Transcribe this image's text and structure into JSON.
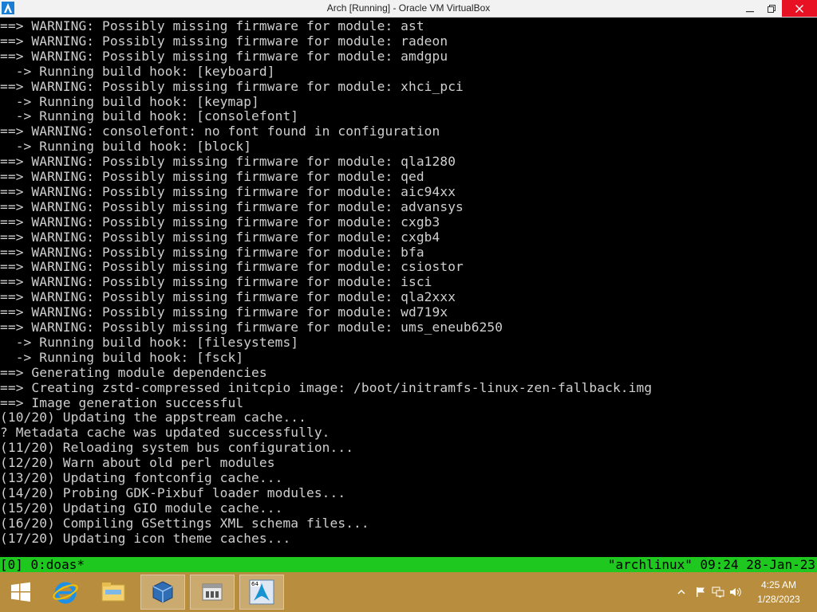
{
  "window": {
    "title": "Arch [Running] - Oracle VM VirtualBox",
    "controls": {
      "minimize": "—",
      "maximize": "❐",
      "close": "✕"
    }
  },
  "console": {
    "lines": [
      "==> WARNING: Possibly missing firmware for module: ast",
      "==> WARNING: Possibly missing firmware for module: radeon",
      "==> WARNING: Possibly missing firmware for module: amdgpu",
      "  -> Running build hook: [keyboard]",
      "==> WARNING: Possibly missing firmware for module: xhci_pci",
      "  -> Running build hook: [keymap]",
      "  -> Running build hook: [consolefont]",
      "==> WARNING: consolefont: no font found in configuration",
      "  -> Running build hook: [block]",
      "==> WARNING: Possibly missing firmware for module: qla1280",
      "==> WARNING: Possibly missing firmware for module: qed",
      "==> WARNING: Possibly missing firmware for module: aic94xx",
      "==> WARNING: Possibly missing firmware for module: advansys",
      "==> WARNING: Possibly missing firmware for module: cxgb3",
      "==> WARNING: Possibly missing firmware for module: cxgb4",
      "==> WARNING: Possibly missing firmware for module: bfa",
      "==> WARNING: Possibly missing firmware for module: csiostor",
      "==> WARNING: Possibly missing firmware for module: isci",
      "==> WARNING: Possibly missing firmware for module: qla2xxx",
      "==> WARNING: Possibly missing firmware for module: wd719x",
      "==> WARNING: Possibly missing firmware for module: ums_eneub6250",
      "  -> Running build hook: [filesystems]",
      "  -> Running build hook: [fsck]",
      "==> Generating module dependencies",
      "==> Creating zstd-compressed initcpio image: /boot/initramfs-linux-zen-fallback.img",
      "==> Image generation successful",
      "(10/20) Updating the appstream cache...",
      "? Metadata cache was updated successfully.",
      "(11/20) Reloading system bus configuration...",
      "(12/20) Warn about old perl modules",
      "(13/20) Updating fontconfig cache...",
      "(14/20) Probing GDK-Pixbuf loader modules...",
      "(15/20) Updating GIO module cache...",
      "(16/20) Compiling GSettings XML schema files...",
      "(17/20) Updating icon theme caches..."
    ]
  },
  "status_bar": {
    "left": "[0] 0:doas*",
    "right": "\"archlinux\" 09:24 28-Jan-23",
    "color": "#1ec81e"
  },
  "taskbar": {
    "color": "#b88e3e",
    "items": [
      {
        "name": "start-button",
        "icon": "windows-logo-icon"
      },
      {
        "name": "internet-explorer",
        "icon": "internet-explorer-icon"
      },
      {
        "name": "file-explorer",
        "icon": "folder-icon"
      },
      {
        "name": "virtualbox-manager",
        "icon": "virtualbox-icon"
      },
      {
        "name": "app-window",
        "icon": "app-window-icon"
      },
      {
        "name": "arch-vm",
        "icon": "arch-linux-icon",
        "badge": "64"
      }
    ],
    "tray_icons": [
      "show-hidden-icons-chevron-icon",
      "action-center-flag-icon",
      "network-icon",
      "volume-icon"
    ],
    "clock": {
      "time": "4:25 AM",
      "date": "1/28/2023"
    }
  }
}
